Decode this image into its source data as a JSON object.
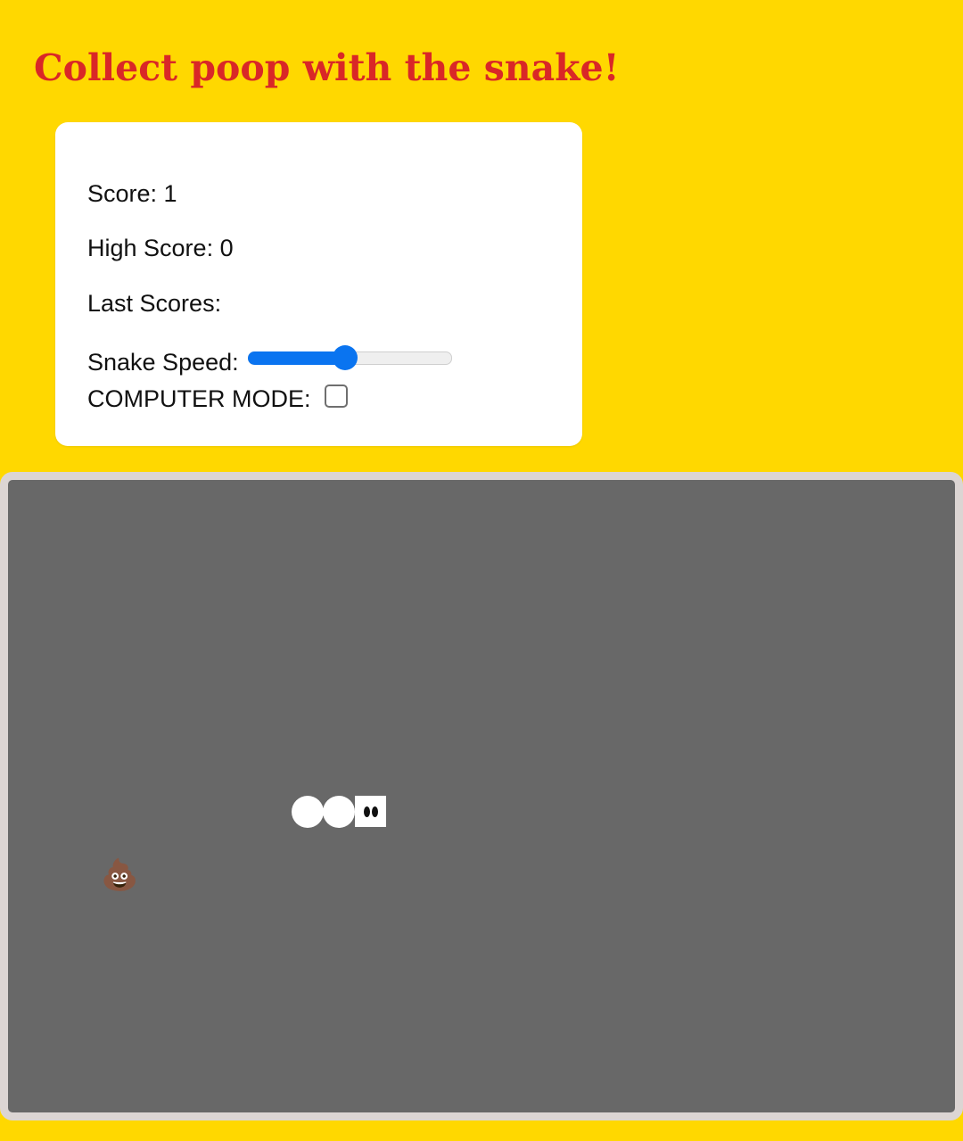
{
  "page": {
    "title": "Collect poop with the snake!"
  },
  "scoreboard": {
    "score": "Score: 1",
    "high_score": "High Score: 0",
    "last_scores": "Last Scores:",
    "speed_label": "Snake Speed:",
    "speed_fraction": 0.47,
    "computer_mode_label": "COMPUTER MODE:",
    "computer_mode_checked": false
  },
  "game": {
    "snake_length": 3,
    "food": "💩",
    "snake_color": "#ffffff",
    "board_color": "#686868",
    "accent": "#0a74f0",
    "title_color": "#d92727"
  }
}
